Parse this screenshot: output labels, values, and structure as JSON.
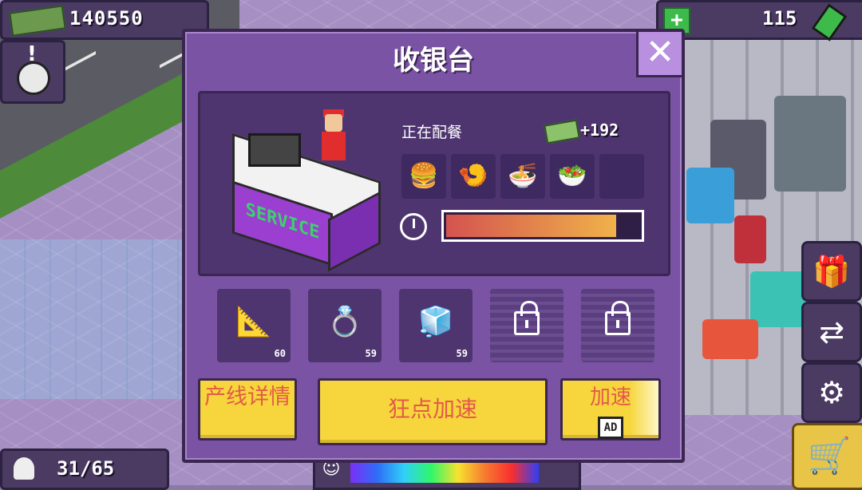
{
  "hud": {
    "money": "140550",
    "energy": "115",
    "population": "31/65"
  },
  "modal": {
    "title": "收银台",
    "close_label": "✕",
    "status_label": "正在配餐",
    "reward": "+192",
    "food_items": [
      {
        "icon": "burger-icon",
        "glyph": "🍔"
      },
      {
        "icon": "shrimp-icon",
        "glyph": "🍤"
      },
      {
        "icon": "noodle-bowl-icon",
        "glyph": "🍜"
      },
      {
        "icon": "salad-bowl-icon",
        "glyph": "🥗"
      },
      {
        "icon": "empty-slot",
        "glyph": ""
      }
    ],
    "progress_fraction": 0.88,
    "upgrades": [
      {
        "icon": "ruler-icon",
        "glyph": "📐",
        "count": "60"
      },
      {
        "icon": "jewel-box-icon",
        "glyph": "💍",
        "count": "59"
      },
      {
        "icon": "sugar-cube-icon",
        "glyph": "🧊",
        "count": "59"
      }
    ],
    "buttons": {
      "details": "产线详情",
      "boost": "狂点加速",
      "ad_boost": "加速",
      "ad_tag": "AD"
    },
    "counter_sign": "SERVICE"
  },
  "colors": {
    "panel": "#7a53a5",
    "button_yellow": "#f6d63c",
    "button_text": "#e35a4a"
  }
}
